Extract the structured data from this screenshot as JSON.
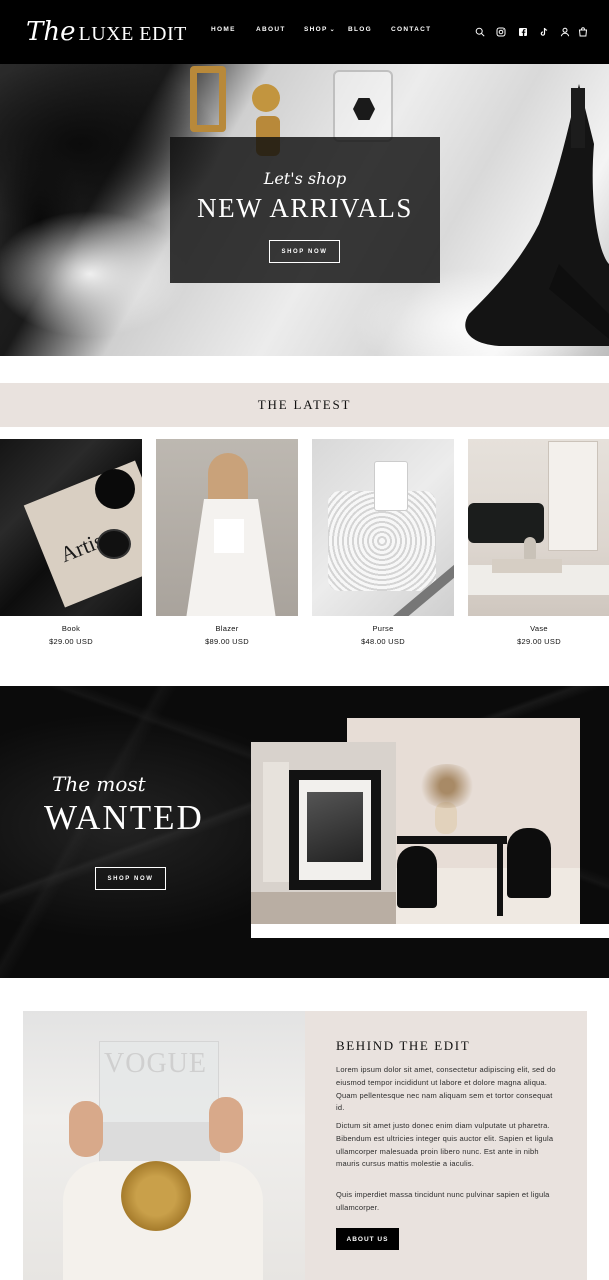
{
  "header": {
    "logo_script": "The",
    "logo_main": "LUXE EDIT",
    "nav": [
      {
        "label": "HOME"
      },
      {
        "label": "ABOUT"
      },
      {
        "label": "SHOP"
      },
      {
        "label": "BLOG"
      },
      {
        "label": "CONTACT"
      }
    ],
    "icons": [
      "search-icon",
      "instagram-icon",
      "facebook-icon",
      "tiktok-icon",
      "account-icon",
      "cart-icon"
    ]
  },
  "hero": {
    "script": "Let's shop",
    "title": "NEW ARRIVALS",
    "button": "SHOP NOW"
  },
  "latest": {
    "title": "THE LATEST",
    "products": [
      {
        "name": "Book",
        "price": "$29.00 USD",
        "cover_text": "Artists"
      },
      {
        "name": "Blazer",
        "price": "$89.00 USD"
      },
      {
        "name": "Purse",
        "price": "$48.00 USD"
      },
      {
        "name": "Vase",
        "price": "$29.00 USD"
      }
    ]
  },
  "wanted": {
    "script": "The most",
    "title": "WANTED",
    "button": "SHOP NOW"
  },
  "behind": {
    "title": "BEHIND THE EDIT",
    "photo_text": "VOGUE",
    "p1": "Lorem ipsum dolor sit amet, consectetur adipiscing elit, sed do eiusmod tempor incididunt ut labore et dolore magna aliqua. Quam pellentesque nec nam aliquam sem et tortor consequat id.",
    "p2": "Dictum sit amet justo donec enim diam vulputate ut pharetra. Bibendum est ultricies integer quis auctor elit. Sapien et ligula ullamcorper malesuada proin libero nunc. Est ante in nibh mauris cursus mattis molestie a iaculis.",
    "p3": "Quis imperdiet massa tincidunt nunc pulvinar sapien et ligula ullamcorper.",
    "button": "ABOUT US"
  }
}
